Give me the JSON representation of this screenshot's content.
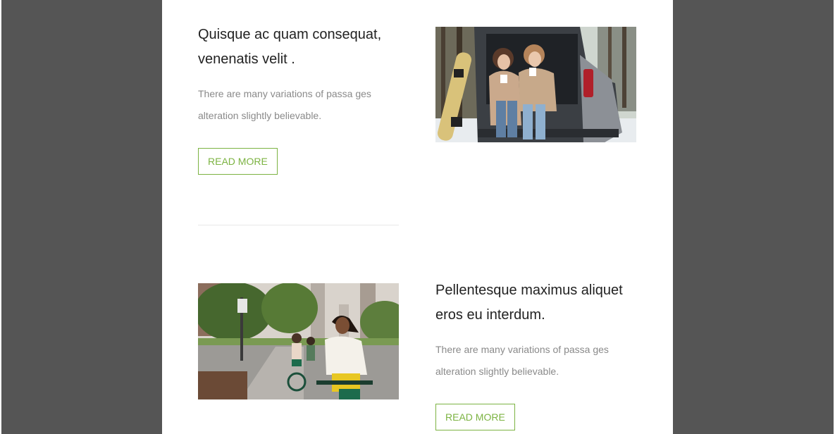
{
  "articles": [
    {
      "title": "Quisque ac quam consequat, venenatis velit .",
      "description": "There are many variations of passa ges alteration slightly believable.",
      "button_label": "READ MORE",
      "image": "two-women-sitting-in-car-trunk-photo"
    },
    {
      "title": "Pellentesque maximus aliquet eros eu interdum.",
      "description": "There are many variations of passa ges alteration slightly believable.",
      "button_label": "READ MORE",
      "image": "woman-riding-bicycle-in-city-photo"
    }
  ],
  "colors": {
    "backdrop": "#555555",
    "card": "#ffffff",
    "accent": "#7cb342",
    "title": "#222222",
    "body_text": "#8a8a8a"
  }
}
